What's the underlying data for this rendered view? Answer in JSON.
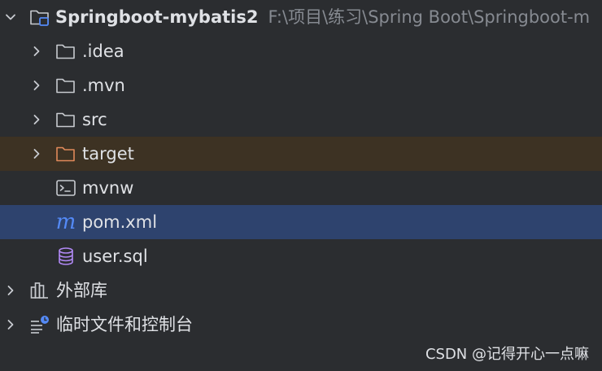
{
  "colors": {
    "background": "#2b2d30",
    "text": "#dfe1e5",
    "path_text": "#868a91",
    "selected_row": "#2e436e",
    "excluded_row": "#3d3223",
    "excluded_folder": "#e0895a",
    "maven_icon": "#548af7",
    "sql_icon": "#b189f5"
  },
  "tree": {
    "root": {
      "name": "Springboot-mybatis2",
      "path": "F:\\项目\\练习\\Spring Boot\\Springboot-m",
      "expanded": true,
      "icon": "module-folder-icon"
    },
    "items": [
      {
        "label": ".idea",
        "icon": "folder-icon",
        "collapsed": true
      },
      {
        "label": ".mvn",
        "icon": "folder-icon",
        "collapsed": true
      },
      {
        "label": "src",
        "icon": "folder-icon",
        "collapsed": true
      },
      {
        "label": "target",
        "icon": "excluded-folder-icon",
        "collapsed": true,
        "excluded": true
      },
      {
        "label": "mvnw",
        "icon": "terminal-script-icon"
      },
      {
        "label": "pom.xml",
        "icon": "maven-icon",
        "selected": true
      },
      {
        "label": "user.sql",
        "icon": "database-icon"
      }
    ],
    "external_libraries": {
      "label": "外部库",
      "icon": "library-icon"
    },
    "scratches": {
      "label": "临时文件和控制台",
      "icon": "scratches-icon"
    }
  },
  "watermark": "CSDN @记得开心一点嘛"
}
